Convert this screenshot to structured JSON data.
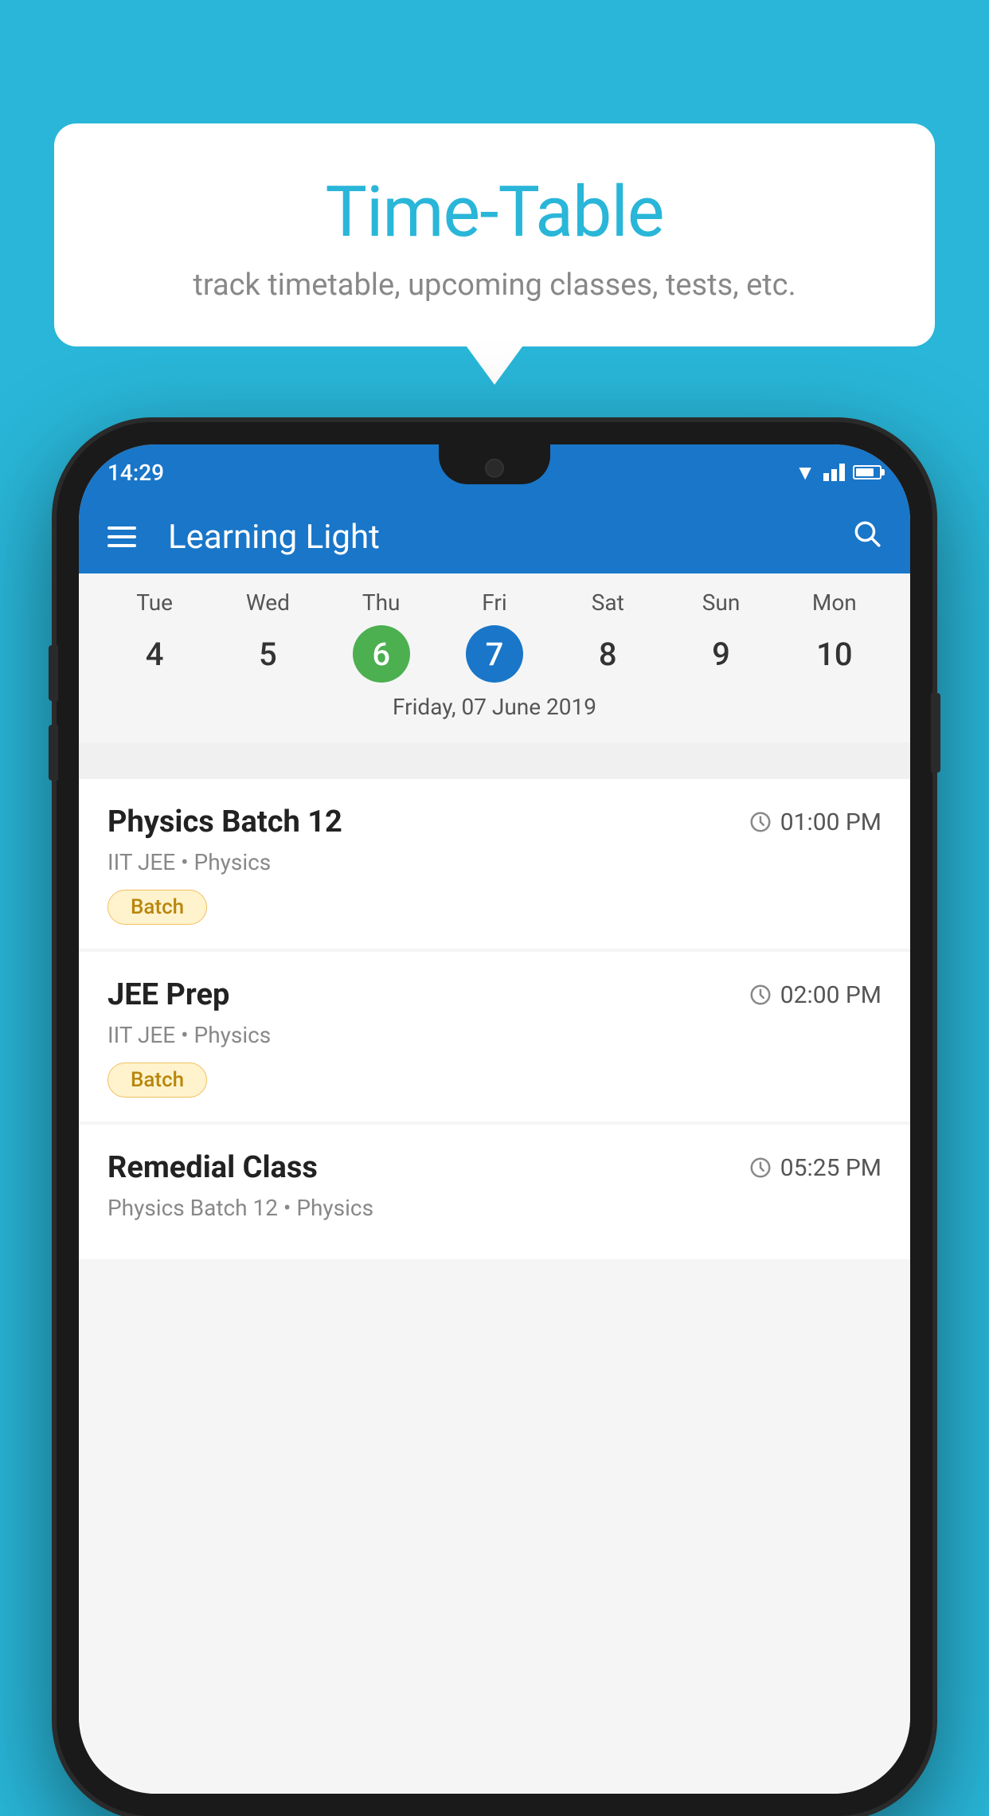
{
  "background_color": "#29b6d8",
  "tooltip": {
    "title": "Time-Table",
    "subtitle": "track timetable, upcoming classes, tests, etc."
  },
  "phone": {
    "status_bar": {
      "time": "14:29",
      "wifi": "▲",
      "battery_level": "70"
    },
    "app_header": {
      "title": "Learning Light"
    },
    "calendar": {
      "days": [
        {
          "name": "Tue",
          "number": "4",
          "state": "normal"
        },
        {
          "name": "Wed",
          "number": "5",
          "state": "normal"
        },
        {
          "name": "Thu",
          "number": "6",
          "state": "today"
        },
        {
          "name": "Fri",
          "number": "7",
          "state": "selected"
        },
        {
          "name": "Sat",
          "number": "8",
          "state": "normal"
        },
        {
          "name": "Sun",
          "number": "9",
          "state": "normal"
        },
        {
          "name": "Mon",
          "number": "10",
          "state": "normal"
        }
      ],
      "selected_date_label": "Friday, 07 June 2019"
    },
    "schedule": [
      {
        "title": "Physics Batch 12",
        "time": "01:00 PM",
        "sub": "IIT JEE • Physics",
        "badge": "Batch"
      },
      {
        "title": "JEE Prep",
        "time": "02:00 PM",
        "sub": "IIT JEE • Physics",
        "badge": "Batch"
      },
      {
        "title": "Remedial Class",
        "time": "05:25 PM",
        "sub": "Physics Batch 12 • Physics",
        "badge": null
      }
    ]
  }
}
